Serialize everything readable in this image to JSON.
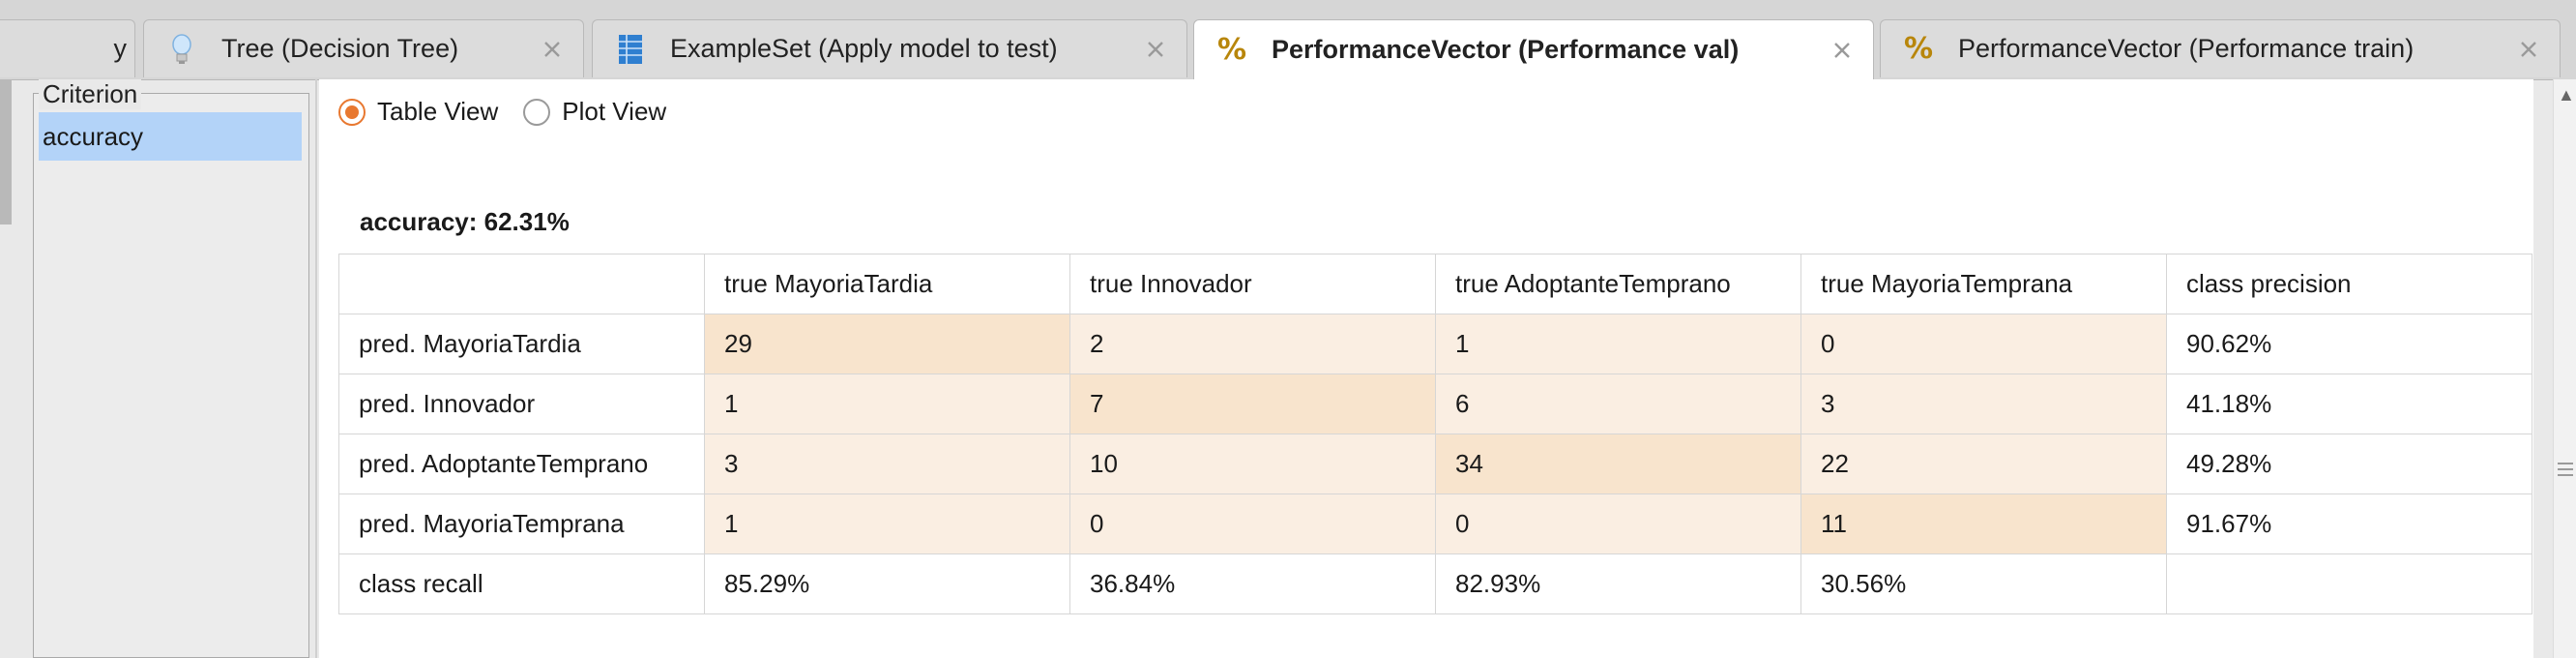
{
  "tabs": [
    {
      "label": "",
      "icon": "partial-tab",
      "active": false
    },
    {
      "label": "Tree (Decision Tree)",
      "icon": "lightbulb-icon",
      "active": false
    },
    {
      "label": "ExampleSet (Apply model to test)",
      "icon": "table-icon",
      "active": false
    },
    {
      "label": "PerformanceVector (Performance val)",
      "icon": "percent-icon",
      "active": true
    },
    {
      "label": "PerformanceVector (Performance train)",
      "icon": "percent-icon",
      "active": false
    }
  ],
  "criterion": {
    "legend": "Criterion",
    "items": [
      "accuracy"
    ],
    "selected": "accuracy"
  },
  "view": {
    "table_label": "Table View",
    "plot_label": "Plot View",
    "selected": "table"
  },
  "accuracy_heading": "accuracy: 62.31%",
  "confusion_matrix": {
    "header": [
      "",
      "true MayoriaTardia",
      "true Innovador",
      "true AdoptanteTemprano",
      "true MayoriaTemprana",
      "class precision"
    ],
    "rows": [
      [
        "pred. MayoriaTardia",
        "29",
        "2",
        "1",
        "0",
        "90.62%"
      ],
      [
        "pred. Innovador",
        "1",
        "7",
        "6",
        "3",
        "41.18%"
      ],
      [
        "pred. AdoptanteTemprano",
        "3",
        "10",
        "34",
        "22",
        "49.28%"
      ],
      [
        "pred. MayoriaTemprana",
        "1",
        "0",
        "0",
        "11",
        "91.67%"
      ]
    ],
    "recall": [
      "class recall",
      "85.29%",
      "36.84%",
      "82.93%",
      "30.56%",
      ""
    ]
  },
  "colors": {
    "accent": "#e87830",
    "selection": "#b3d3f8",
    "cell_light": "#faeee2",
    "cell_diag": "#f8e4cd"
  }
}
